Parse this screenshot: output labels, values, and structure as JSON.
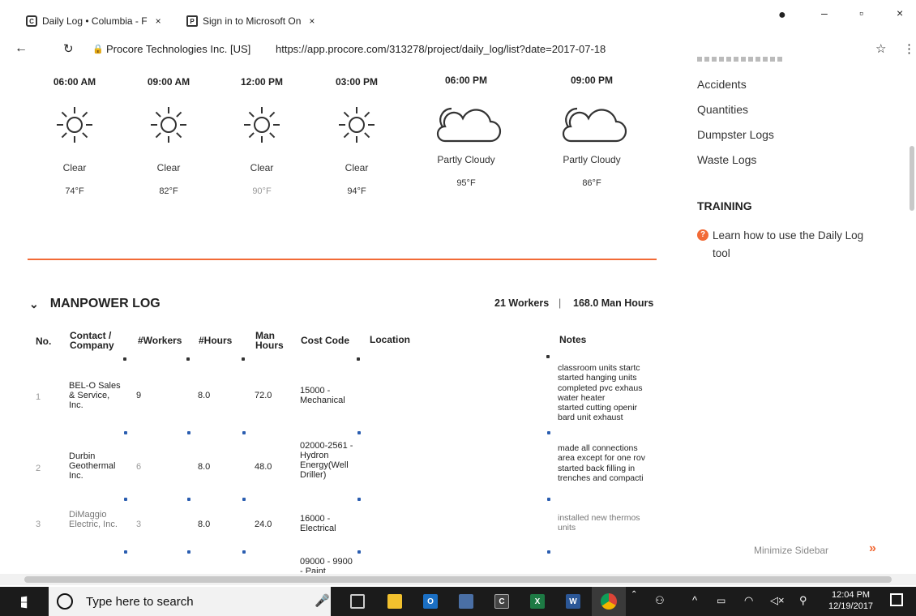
{
  "browser": {
    "tabs": [
      {
        "label": "Daily Log • Columbia - F",
        "icon": "procore-icon"
      },
      {
        "label": "Sign in to Microsoft On",
        "icon": "microsoft-icon"
      }
    ],
    "site_identity": "Procore Technologies Inc. [US]",
    "url": "https://app.procore.com/313278/project/daily_log/list?date=2017-07-18"
  },
  "weather": [
    {
      "time": "06:00 AM",
      "condition": "Clear",
      "temp": "74°F",
      "icon": "sun-icon"
    },
    {
      "time": "09:00 AM",
      "condition": "Clear",
      "temp": "82°F",
      "icon": "sun-icon"
    },
    {
      "time": "12:00 PM",
      "condition": "Clear",
      "temp": "90°F",
      "icon": "sun-icon"
    },
    {
      "time": "03:00 PM",
      "condition": "Clear",
      "temp": "94°F",
      "icon": "sun-icon"
    },
    {
      "time": "06:00 PM",
      "condition": "Partly Cloudy",
      "temp": "95°F",
      "icon": "moon-cloud-icon"
    },
    {
      "time": "09:00 PM",
      "condition": "Partly Cloudy",
      "temp": "86°F",
      "icon": "moon-cloud-icon"
    }
  ],
  "sidebar": {
    "links": [
      "Accidents",
      "Quantities",
      "Dumpster Logs",
      "Waste Logs"
    ],
    "training_title": "TRAINING",
    "training_link": "Learn how to use the Daily Log tool",
    "minimize_label": "Minimize Sidebar"
  },
  "manpower": {
    "title": "MANPOWER LOG",
    "workers_summary": "21 Workers",
    "separator": "|",
    "hours_summary": "168.0 Man Hours",
    "columns": {
      "no": "No.",
      "company": "Contact / Company",
      "workers": "#Workers",
      "hours": "#Hours",
      "man_hours": "Man Hours",
      "cost_code": "Cost Code",
      "location": "Location",
      "notes": "Notes"
    },
    "rows": [
      {
        "no": "1",
        "company": "BEL-O Sales & Service, Inc.",
        "workers": "9",
        "hours": "8.0",
        "man_hours": "72.0",
        "cost_code": "15000 - Mechanical",
        "notes": [
          "classroom units startc",
          "started hanging units",
          "completed pvc exhaus",
          "water heater",
          "started cutting openir",
          "bard unit exhaust"
        ]
      },
      {
        "no": "2",
        "company": "Durbin Geothermal Inc.",
        "workers": "6",
        "hours": "8.0",
        "man_hours": "48.0",
        "cost_code": "02000-2561 - Hydron Energy(Well Driller)",
        "notes": [
          "made all connections",
          "area except for one rov",
          "started back filling in",
          "trenches and compacti"
        ]
      },
      {
        "no": "3",
        "company": "DiMaggio Electric, Inc.",
        "workers": "3",
        "hours": "8.0",
        "man_hours": "24.0",
        "cost_code": "16000 - Electrical",
        "notes": [
          "installed new thermos",
          "units"
        ]
      },
      {
        "no": "",
        "company": "",
        "workers": "",
        "hours": "",
        "man_hours": "",
        "cost_code": "09000 - 9900 - Paint",
        "notes": []
      }
    ]
  },
  "taskbar": {
    "search_placeholder": "Type here to search",
    "time": "12:04 PM",
    "date": "12/19/2017"
  },
  "colors": {
    "accent": "#f26a36",
    "link_dot": "#2a5db0",
    "taskbar": "#1b1b1b"
  }
}
